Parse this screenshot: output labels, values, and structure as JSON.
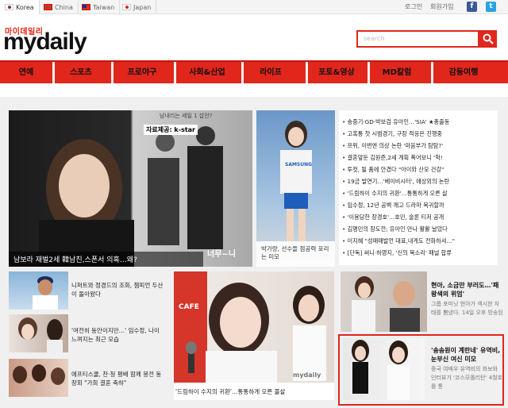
{
  "topbar": {
    "languages": [
      {
        "label": "Korea",
        "flag": "korea-flag-icon"
      },
      {
        "label": "China",
        "flag": "china-flag-icon"
      },
      {
        "label": "Taiwan",
        "flag": "taiwan-flag-icon"
      },
      {
        "label": "Japan",
        "flag": "japan-flag-icon"
      }
    ],
    "login": "로그인",
    "signup": "회원가입",
    "facebook": "f",
    "twitter": "t"
  },
  "header": {
    "logo_korean": "마이데일리",
    "logo": "mydaily",
    "search_placeholder": "search"
  },
  "nav": {
    "items": [
      "연예",
      "스포츠",
      "프로야구",
      "사회&산업",
      "라이프",
      "포토&영상",
      "MD칼럼",
      "감동여행"
    ]
  },
  "photos": {
    "main_caption": "남보라 재벌2세 韓남친,스폰서 의혹…왜?",
    "main_stamp": "자료제공: k-star",
    "main_top_text": "남내리는 세일 1 삽안?",
    "main_watermark": "너무~니",
    "second_caption": "박가량, 선수들 점공력 포리는 미모",
    "second_uniform": "SAMSUNG",
    "suzy_watermark": "mydaily",
    "suzy_sign": "CAFE"
  },
  "headlines": [
    "송중기·GD·박보검 유아인…'SIA' ★총출동",
    "고혹통 첫 시범경기, 구장 적응은 진행중",
    "쯔위, 이번엔 의상 논란 '마음부가 탐탐?'",
    "결혼앞둔 김원준,2세 계획 폭어보니 '헉!",
    "투컷, 될 품에 안겼다 \"아이와 산모 건강\"",
    "19금 발연기…'베이비시터', 애상외의 논란",
    "'드림하이 수지의 귀환'…통통하게 오른 살",
    "임수정, 12년 공백 깨고 드라마 복귀할까",
    "'이용당한 장경호'…호민, 술론 티저 공개",
    "김명민의 장도전; 유아인 만나 활활 날았다",
    "이지혜 \"성매매발언 대표,내게도 전화하셔…\"",
    "[단독] 써니·하영지, '신의 목소리' 패널 합류"
  ],
  "stories": {
    "s1": "니퍼트와 정경드의 조화, 챔피언 두산이 돌아왔다",
    "s2": "'여전히 동안이지만…' 임수정, 나이 느껴지는 최근 모습",
    "s3": "에프티스쿨, 찬·청 평배 함께 몽전 동창회 \"가회 결혼 축하\"",
    "suzy_caption": "'드림하이 수지의 귀환'…통통하게 오른 볼살",
    "r1_title": "현아, 소금만 부러도…'패왕색의 위엄'",
    "r1_desc": "그룹 포미닛 현아가 섹시한 자태를 뽐냈다. 14일 오후 방송된",
    "r2_title": "'송송원이 계란네' 유역비,눈부신 여신 미모",
    "r2_desc": "중국 여배우 유역비의 화보와 인터뷰가 '코스모폴리탄' 4월호를 통"
  }
}
